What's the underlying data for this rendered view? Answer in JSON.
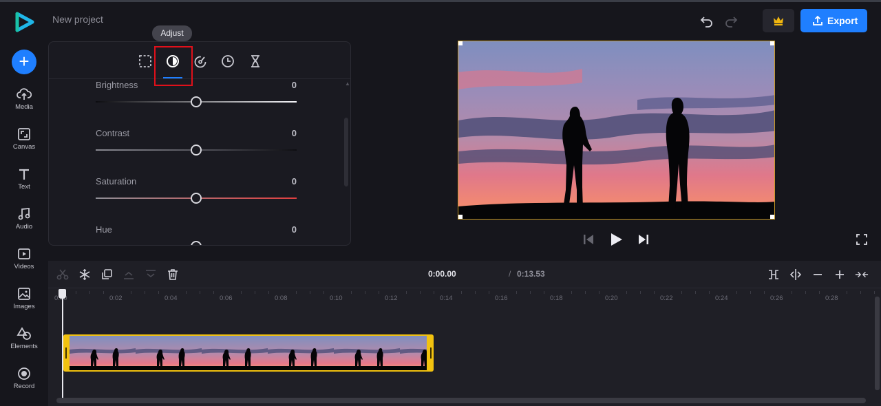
{
  "app": {
    "project_name": "New project",
    "export_label": "Export"
  },
  "sidebar": {
    "items": [
      {
        "label": "Media",
        "icon": "cloud-upload-icon"
      },
      {
        "label": "Canvas",
        "icon": "canvas-resize-icon"
      },
      {
        "label": "Text",
        "icon": "text-icon"
      },
      {
        "label": "Audio",
        "icon": "music-note-icon"
      },
      {
        "label": "Videos",
        "icon": "video-play-icon"
      },
      {
        "label": "Images",
        "icon": "image-icon"
      },
      {
        "label": "Elements",
        "icon": "shapes-icon"
      },
      {
        "label": "Record",
        "icon": "record-icon"
      }
    ]
  },
  "panel": {
    "tooltip": "Adjust",
    "active_tab": "adjust",
    "tabs": [
      "crop",
      "adjust",
      "speed",
      "timing",
      "duration"
    ],
    "adjustments": [
      {
        "name": "Brightness",
        "value": "0",
        "level": 0.5
      },
      {
        "name": "Contrast",
        "value": "0",
        "level": 0.5
      },
      {
        "name": "Saturation",
        "value": "0",
        "level": 0.5
      },
      {
        "name": "Hue",
        "value": "0",
        "level": 0.5
      }
    ]
  },
  "timeline": {
    "current_time": "0:00.00",
    "separator": "/",
    "total_time": "0:13.53",
    "ticks": [
      "0:00",
      "0:02",
      "0:04",
      "0:06",
      "0:08",
      "0:10",
      "0:12",
      "0:14",
      "0:16",
      "0:18",
      "0:20",
      "0:22",
      "0:24",
      "0:26",
      "0:28"
    ]
  },
  "colors": {
    "accent": "#1f7fff",
    "clip_border": "#f2c20f",
    "highlight": "#e0101a",
    "crown": "#f2b70f"
  }
}
